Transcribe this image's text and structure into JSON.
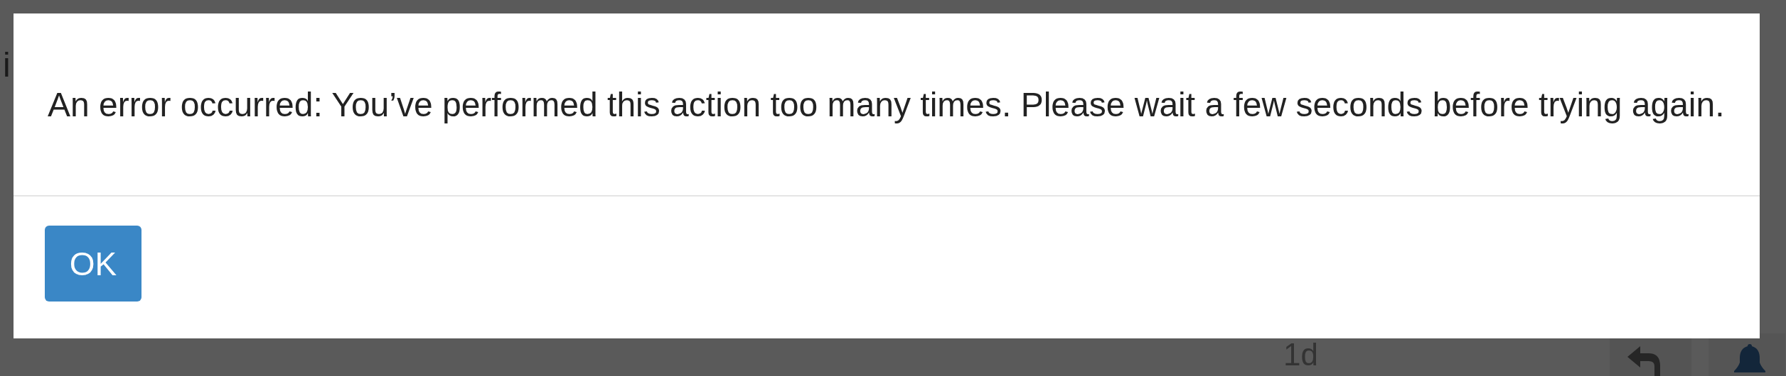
{
  "background": {
    "text": "i",
    "timestamp": "1d"
  },
  "dialog": {
    "message": "An error occurred: You’ve performed this action too many times. Please wait a few seconds before trying again.",
    "buttons": [
      "OK"
    ]
  }
}
